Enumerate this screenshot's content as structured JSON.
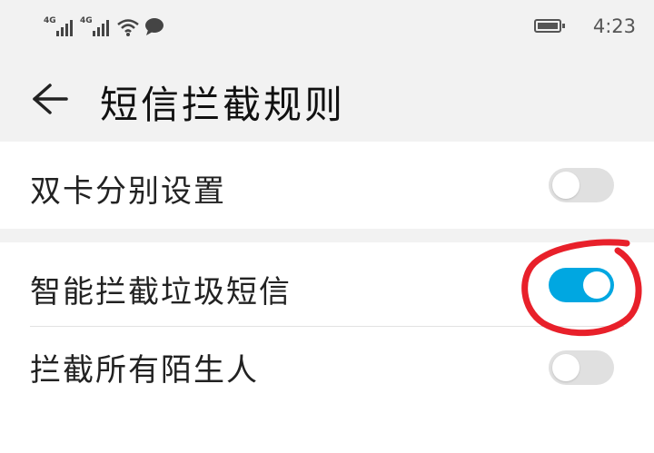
{
  "status_bar": {
    "network1": "4G",
    "network2": "4G",
    "wifi_icon": "wifi-icon",
    "chat_icon": "message-icon",
    "battery_icon": "battery-icon",
    "time": "4:23"
  },
  "header": {
    "back_icon": "arrow-left-icon",
    "title": "短信拦截规则"
  },
  "settings": [
    {
      "label": "双卡分别设置",
      "enabled": false
    },
    {
      "label": "智能拦截垃圾短信",
      "enabled": true
    },
    {
      "label": "拦截所有陌生人",
      "enabled": false
    }
  ],
  "colors": {
    "accent": "#00a7e1",
    "annotation": "#e8202a",
    "background": "#f2f2f2"
  }
}
